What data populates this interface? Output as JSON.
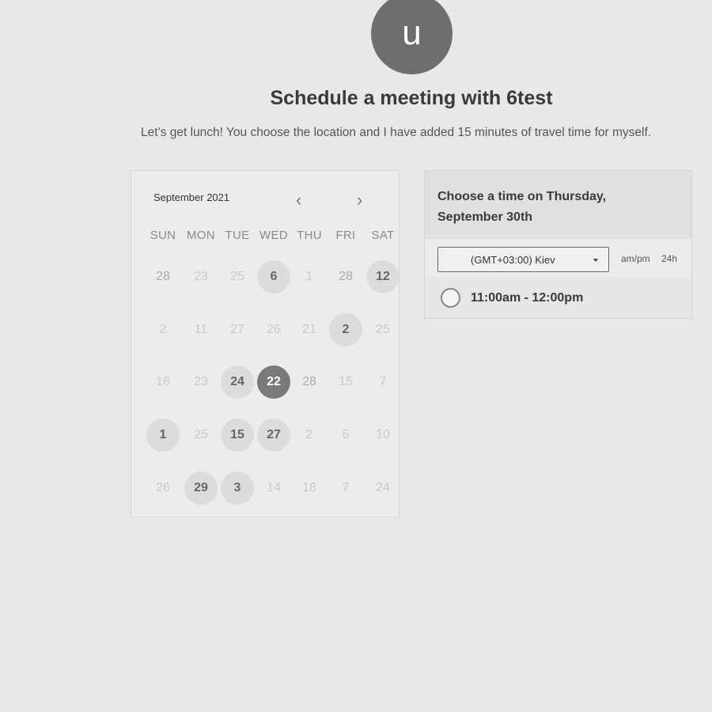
{
  "avatar": {
    "initial": "u"
  },
  "title": "Schedule a meeting with 6test",
  "subtitle": "Let’s get lunch! You choose the location and I have added 15 minutes of travel time for myself.",
  "calendar": {
    "month_label": "September 2021",
    "prev_icon": "‹",
    "next_icon": "›",
    "weekdays": [
      "SUN",
      "MON",
      "TUE",
      "WED",
      "THU",
      "FRI",
      "SAT"
    ],
    "weeks": [
      [
        {
          "d": "28",
          "s": "muted"
        },
        {
          "d": "23",
          "s": "inactive"
        },
        {
          "d": "25",
          "s": "inactive"
        },
        {
          "d": "6",
          "s": "available"
        },
        {
          "d": "1",
          "s": "inactive"
        },
        {
          "d": "28",
          "s": "muted"
        },
        {
          "d": "12",
          "s": "available"
        }
      ],
      [
        {
          "d": "2",
          "s": "inactive"
        },
        {
          "d": "11",
          "s": "inactive"
        },
        {
          "d": "27",
          "s": "inactive"
        },
        {
          "d": "26",
          "s": "inactive"
        },
        {
          "d": "21",
          "s": "inactive"
        },
        {
          "d": "2",
          "s": "available"
        },
        {
          "d": "25",
          "s": "inactive"
        }
      ],
      [
        {
          "d": "16",
          "s": "inactive"
        },
        {
          "d": "23",
          "s": "inactive"
        },
        {
          "d": "24",
          "s": "available"
        },
        {
          "d": "22",
          "s": "selected"
        },
        {
          "d": "28",
          "s": "muted"
        },
        {
          "d": "15",
          "s": "inactive"
        },
        {
          "d": "7",
          "s": "inactive"
        }
      ],
      [
        {
          "d": "1",
          "s": "available"
        },
        {
          "d": "25",
          "s": "inactive"
        },
        {
          "d": "15",
          "s": "available"
        },
        {
          "d": "27",
          "s": "available"
        },
        {
          "d": "2",
          "s": "inactive"
        },
        {
          "d": "6",
          "s": "inactive"
        },
        {
          "d": "10",
          "s": "inactive"
        }
      ],
      [
        {
          "d": "26",
          "s": "inactive"
        },
        {
          "d": "29",
          "s": "available"
        },
        {
          "d": "3",
          "s": "available"
        },
        {
          "d": "14",
          "s": "inactive"
        },
        {
          "d": "18",
          "s": "inactive"
        },
        {
          "d": "7",
          "s": "inactive"
        },
        {
          "d": "24",
          "s": "inactive"
        }
      ]
    ]
  },
  "time_panel": {
    "heading": "Choose a time on Thursday, September 30th",
    "timezone": "(GMT+03:00) Kiev",
    "format_ampm": "am/pm",
    "format_24h": "24h",
    "slots": [
      "11:00am - 12:00pm"
    ]
  },
  "colors": {
    "background": "#e8e8e8",
    "selected_day": "#7a7a7a",
    "available_day": "#dcdcdc"
  }
}
